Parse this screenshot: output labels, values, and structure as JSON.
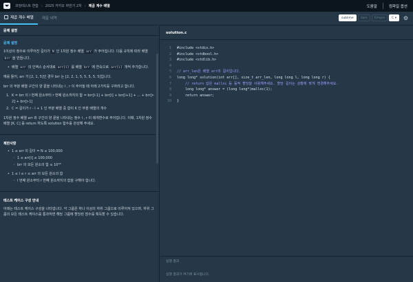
{
  "topbar": {
    "crumbs": [
      "코딩테스트 연습",
      "2025 카카오 하반기 2차",
      "제곱 계수 배열"
    ],
    "links": [
      "도움말",
      "컴파일 옵션"
    ]
  },
  "tabs": {
    "items": [
      "제곱 계수 배열",
      "제출 내역"
    ],
    "theme": "sublime",
    "ghost_buttons": [
      "dark",
      "Simple"
    ],
    "language": "C"
  },
  "problem": {
    "header": "문제 설명",
    "desc_title": "문제 설명",
    "para1_a": "1이상의 정수로 이루어진 길이가 ",
    "para1_n": "N",
    "para1_b": " 인 1차원 정수 배열 ",
    "para1_arr": "arr",
    "para1_c": " 가 주어집니다. 다음 규칙에 따라 배열 ",
    "para1_brr": "brr",
    "para1_d": " 을 만듭니다.",
    "bullet1_a": "배열 ",
    "bullet1_arr": "arr",
    "bullet1_b": " 의 인덱스 순서대로 ",
    "bullet1_ai": "arr[i]",
    "bullet1_c": " 를 배열 ",
    "bullet1_brr": "brr",
    "bullet1_d": " 에 연속으로 ",
    "bullet1_ai2": "arr[i]",
    "bullet1_e": " 개씩 추가합니다.",
    "example": "예를 들어, arr 가 [2, 1, 5]인 경우 brr 는 [2, 2, 1, 5, 5, 5, 5, 5]입니다.",
    "para2": "brr 의 부분 배열 구간의 양 끝을 나타내는 l , r 이 주어질 때 아래 2가지를 구하려고 합니다.",
    "item1_a": "K = brr 의 l 번째 원소부터 r 번째 원소까지의 합 = brr[l-1] + brr[l] + brr[l+1] + ... + brr[r-2] + brr[r-1]",
    "item2": "C = 길이가 r - l + 1 인 부분 배열 중 합이 K 인 부분 배열의 개수",
    "para3": "1차원 정수 배열 arr 와 구간의 양 끝을 나타내는 정수 l , r 이 매개변수로 주어집니다. 이때, 1차원 정수 배열 [K, C] 를 return 하도록 solution 함수를 완성해 주세요.",
    "constraints_title": "제한사항",
    "c1": "1 ≤ arr 의 길이 = N ≤ 100,000",
    "c1a": "1 ≤ arr[i] ≤ 100,000",
    "c1b": "brr 의 모든 원소의 합 ≤ 10¹⁸",
    "c2": "1 ≤ l ≤ r ≤ arr 의 모든 원소의 합",
    "c2a": "l 번째 원소부터 r 번째 원소까지의 합을 구해야 합니다.",
    "testcase_title": "테스트 케이스 구성 안내",
    "testcase_para": "아래는 테스트 케이스 구성을 나타냅니다. 각 그룹은 하나 이상의 하위 그룹으로 이루어져 있으며, 하위 그룹의 모든 테스트 케이스를 통과하면 해당 그룹에 할당된 점수를 획득할 수 있습니다."
  },
  "editor": {
    "filename": "solution.c",
    "lines": [
      {
        "n": "1",
        "code": "#include <stdio.h>"
      },
      {
        "n": "2",
        "code": "#include <stdbool.h>"
      },
      {
        "n": "3",
        "code": "#include <stdlib.h>"
      },
      {
        "n": "4",
        "code": ""
      },
      {
        "n": "5",
        "code": "// arr_len은 배열 arr의 길이입니다."
      },
      {
        "n": "6",
        "code": "long long* solution(int arr[], size_t arr_len, long long l, long long r) {"
      },
      {
        "n": "7",
        "code": "    // return 값은 malloc 등 동적 할당을 사용해주세요. 할당 길이는 상황에 맞게 변경해주세요."
      },
      {
        "n": "8",
        "code": "    long long* answer = (long long*)malloc(1);"
      },
      {
        "n": "9",
        "code": "    return answer;"
      },
      {
        "n": "10",
        "code": "}"
      }
    ]
  },
  "results": {
    "title": "실행 결과",
    "message": "실행 결과가 여기에 표시됩니다."
  }
}
